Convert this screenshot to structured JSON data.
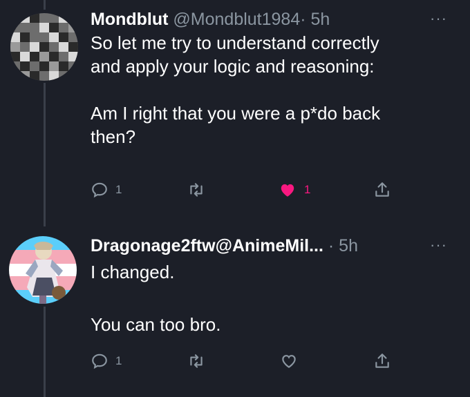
{
  "tweets": [
    {
      "name": "Mondblut",
      "handle": "@Mondblut1984",
      "separator": "·",
      "time": "5h",
      "more": "···",
      "lines": [
        "So let me try to understand correctly",
        "and apply your logic and reasoning:",
        "",
        "Am I right that you were a p*do back",
        "then?"
      ],
      "reply_count": "1",
      "like_count": "1",
      "liked": true
    },
    {
      "name": "Dragonage2ftw",
      "handle": "@AnimeMil...",
      "separator": "·",
      "time": "5h",
      "more": "···",
      "lines": [
        "I changed.",
        "",
        "You can too bro."
      ],
      "reply_count": "1",
      "like_count": "",
      "liked": false
    }
  ],
  "colors": {
    "background": "#1c1f28",
    "secondary_text": "#8b96a1",
    "like_active": "#f91880",
    "thread_line": "#3a3f4a"
  },
  "icons": [
    "reply-icon",
    "retweet-icon",
    "like-icon",
    "share-icon",
    "more-icon"
  ]
}
